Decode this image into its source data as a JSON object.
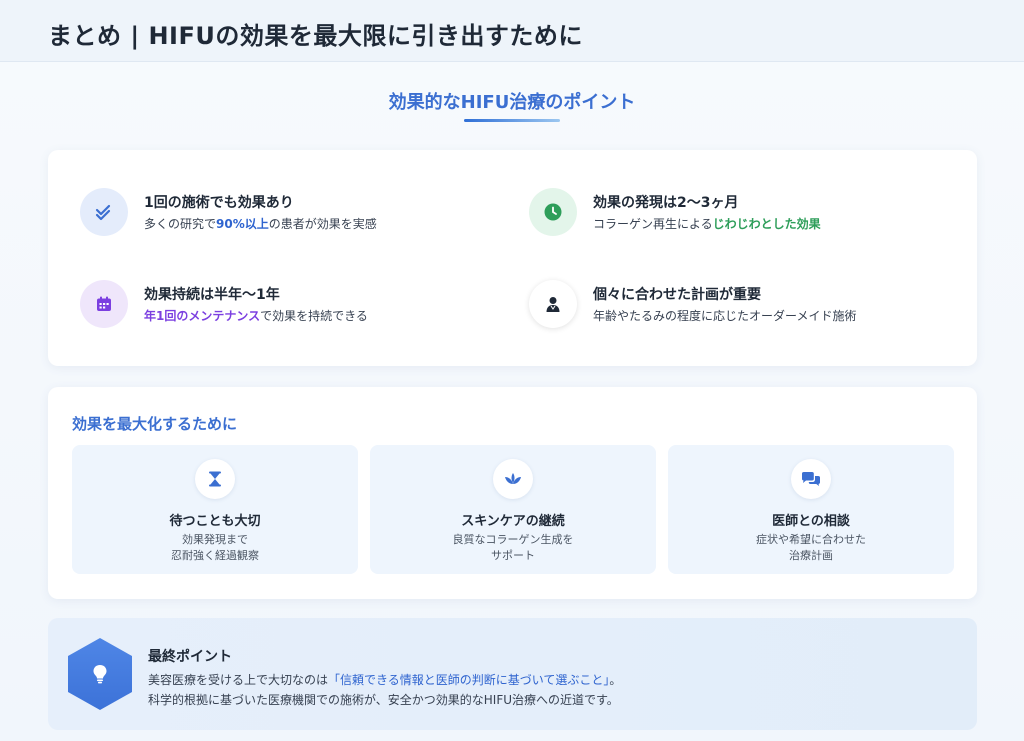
{
  "header": {
    "title": "まとめ | HIFUの効果を最大限に引き出すために"
  },
  "section": {
    "title": "効果的なHIFU治療のポイント"
  },
  "points": [
    {
      "icon": "double-check-icon",
      "title": "1回の施術でも効果あり",
      "desc_pre": "多くの研究で",
      "desc_hl": "90%以上",
      "desc_post": "の患者が効果を実感"
    },
    {
      "icon": "clock-icon",
      "title": "効果の発現は2〜3ヶ月",
      "desc_pre": "コラーゲン再生による",
      "desc_hl": "じわじわとした効果",
      "desc_post": ""
    },
    {
      "icon": "calendar-icon",
      "title": "効果持続は半年〜1年",
      "desc_pre": "",
      "desc_hl": "年1回のメンテナンス",
      "desc_post": "で効果を持続できる"
    },
    {
      "icon": "doctor-icon",
      "title": "個々に合わせた計画が重要",
      "desc_pre": "年齢やたるみの程度に応じたオーダーメイド施術",
      "desc_hl": "",
      "desc_post": ""
    }
  ],
  "maximize": {
    "title": "効果を最大化するために",
    "tips": [
      {
        "icon": "hourglass-icon",
        "title": "待つことも大切",
        "line1": "効果発現まで",
        "line2": "忍耐強く経過観察"
      },
      {
        "icon": "lotus-icon",
        "title": "スキンケアの継続",
        "line1": "良質なコラーゲン生成を",
        "line2": "サポート"
      },
      {
        "icon": "chat-icon",
        "title": "医師との相談",
        "line1": "症状や希望に合わせた",
        "line2": "治療計画"
      }
    ]
  },
  "final": {
    "icon": "lightbulb-icon",
    "title": "最終ポイント",
    "line1_pre": "美容医療を受ける上で大切なのは",
    "line1_hl": "「信頼できる情報と医師の判断に基づいて選ぶこと」",
    "line1_post": "。",
    "line2": "科学的根拠に基づいた医療機関での施術が、安全かつ効果的なHIFU治療への近道です。"
  },
  "colors": {
    "accent_blue": "#3b6fd1",
    "highlight_blue": "#2f64cf",
    "highlight_green": "#2e9e5a",
    "highlight_purple": "#7b3fe0"
  }
}
